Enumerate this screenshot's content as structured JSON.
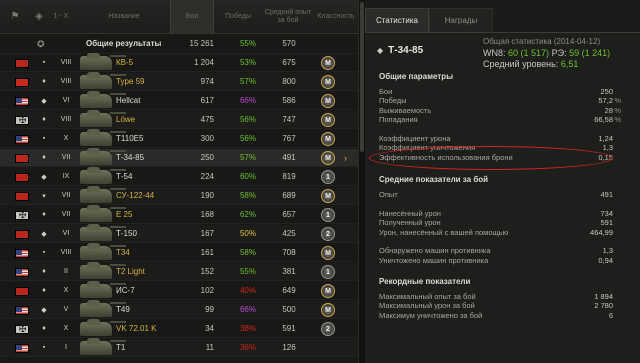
{
  "table": {
    "headers": {
      "sort": "1 - X",
      "name": "Название",
      "battles": "Бои",
      "wins": "Победы",
      "avg_xp": "Средний опыт за бой",
      "class": "Классность"
    },
    "total": {
      "label": "Общие результаты",
      "battles": "15 261",
      "wins": "55%",
      "avg_xp": "570"
    },
    "rows": [
      {
        "nation": "ussr",
        "tier": "VIII",
        "name": "КВ-5",
        "battles": "1 204",
        "wins": "53%",
        "avg_xp": "675",
        "badge": "M",
        "win_color": "#6bc12d",
        "name_color": "gold"
      },
      {
        "nation": "china",
        "tier": "VIII",
        "name": "Type 59",
        "battles": "974",
        "wins": "57%",
        "avg_xp": "800",
        "badge": "M",
        "win_color": "#6bc12d",
        "name_color": "gold"
      },
      {
        "nation": "usa",
        "tier": "VI",
        "name": "Hellcat",
        "battles": "617",
        "wins": "66%",
        "avg_xp": "586",
        "badge": "M",
        "win_color": "#b74fd4",
        "name_color": "white"
      },
      {
        "nation": "germany",
        "tier": "VIII",
        "name": "Löwe",
        "battles": "475",
        "wins": "56%",
        "avg_xp": "747",
        "badge": "M",
        "win_color": "#6bc12d",
        "name_color": "gold"
      },
      {
        "nation": "usa",
        "tier": "X",
        "name": "T110E5",
        "battles": "300",
        "wins": "56%",
        "avg_xp": "767",
        "badge": "M",
        "win_color": "#6bc12d",
        "name_color": "white"
      },
      {
        "nation": "ussr",
        "tier": "VII",
        "name": "Т-34-85",
        "battles": "250",
        "wins": "57%",
        "avg_xp": "491",
        "badge": "M",
        "win_color": "#6bc12d",
        "name_color": "white"
      },
      {
        "nation": "ussr",
        "tier": "IX",
        "name": "Т-54",
        "battles": "224",
        "wins": "60%",
        "avg_xp": "819",
        "badge": "1",
        "win_color": "#6bc12d",
        "name_color": "white"
      },
      {
        "nation": "ussr",
        "tier": "VII",
        "name": "СУ-122-44",
        "battles": "190",
        "wins": "58%",
        "avg_xp": "689",
        "badge": "M",
        "win_color": "#6bc12d",
        "name_color": "gold"
      },
      {
        "nation": "germany",
        "tier": "VII",
        "name": "E 25",
        "battles": "168",
        "wins": "62%",
        "avg_xp": "657",
        "badge": "1",
        "win_color": "#6bc12d",
        "name_color": "gold"
      },
      {
        "nation": "ussr",
        "tier": "VI",
        "name": "Т-150",
        "battles": "167",
        "wins": "50%",
        "avg_xp": "425",
        "badge": "2",
        "win_color": "#e0c33a",
        "name_color": "white"
      },
      {
        "nation": "usa",
        "tier": "VIII",
        "name": "T34",
        "battles": "161",
        "wins": "58%",
        "avg_xp": "708",
        "badge": "M",
        "win_color": "#6bc12d",
        "name_color": "gold"
      },
      {
        "nation": "usa",
        "tier": "II",
        "name": "T2 Light",
        "battles": "152",
        "wins": "55%",
        "avg_xp": "381",
        "badge": "1",
        "win_color": "#6bc12d",
        "name_color": "gold"
      },
      {
        "nation": "ussr",
        "tier": "X",
        "name": "ИС-7",
        "battles": "102",
        "wins": "40%",
        "avg_xp": "649",
        "badge": "M",
        "win_color": "#d4241b",
        "name_color": "white"
      },
      {
        "nation": "usa",
        "tier": "V",
        "name": "T49",
        "battles": "99",
        "wins": "66%",
        "avg_xp": "500",
        "badge": "M",
        "win_color": "#b74fd4",
        "name_color": "white"
      },
      {
        "nation": "germany",
        "tier": "X",
        "name": "VK 72.01 K",
        "battles": "34",
        "wins": "38%",
        "avg_xp": "591",
        "badge": "2",
        "win_color": "#d4241b",
        "name_color": "gold"
      },
      {
        "nation": "usa",
        "tier": "I",
        "name": "T1",
        "battles": "11",
        "wins": "36%",
        "avg_xp": "126",
        "badge": "",
        "win_color": "#d4241b",
        "name_color": "white"
      }
    ]
  },
  "panel": {
    "tabs": [
      "Статистика",
      "Награды"
    ],
    "tank": "Т-34-85",
    "general_stats": "Общая статистика (2014-04-12)",
    "wn8_label": "WN8:",
    "wn8_value": "60 (1 517)",
    "re_label": "РЭ:",
    "re_value": "59 (1 241)",
    "avg_level_label": "Средний уровень:",
    "avg_level_value": "6,51",
    "sections": [
      {
        "title": "Общие параметры",
        "rows": [
          {
            "label": "Бои",
            "value": "250",
            "unit": ""
          },
          {
            "label": "Победы",
            "value": "57,2",
            "unit": "%"
          },
          {
            "label": "Выживаемость",
            "value": "28",
            "unit": "%"
          },
          {
            "label": "Попадания",
            "value": "66,58",
            "unit": "%"
          },
          {
            "label": "",
            "value": "",
            "unit": ""
          },
          {
            "label": "Коэффициент урона",
            "value": "1,24",
            "unit": ""
          },
          {
            "label": "Коэффициент уничтожения",
            "value": "1,3",
            "unit": ""
          },
          {
            "label": "Эффективность использования брони",
            "value": "0,15",
            "unit": ""
          }
        ]
      },
      {
        "title": "Средние показатели за бой",
        "rows": [
          {
            "label": "Опыт",
            "value": "491",
            "unit": ""
          },
          {
            "label": "",
            "value": "",
            "unit": ""
          },
          {
            "label": "Нанесённый урон",
            "value": "734",
            "unit": ""
          },
          {
            "label": "Полученный урон",
            "value": "591",
            "unit": ""
          },
          {
            "label": "Урон, нанесённый с вашей помощью",
            "value": "464,99",
            "unit": ""
          },
          {
            "label": "",
            "value": "",
            "unit": ""
          },
          {
            "label": "Обнаружено машин противника",
            "value": "1,3",
            "unit": ""
          },
          {
            "label": "Уничтожено машин противника",
            "value": "0,94",
            "unit": ""
          }
        ]
      },
      {
        "title": "Рекордные показатели",
        "rows": [
          {
            "label": "Максимальный опыт за бой",
            "value": "1 894",
            "unit": ""
          },
          {
            "label": "Максимальный урон за бой",
            "value": "2 780",
            "unit": ""
          },
          {
            "label": "Максимум уничтожено за бой",
            "value": "6",
            "unit": ""
          }
        ]
      }
    ]
  }
}
